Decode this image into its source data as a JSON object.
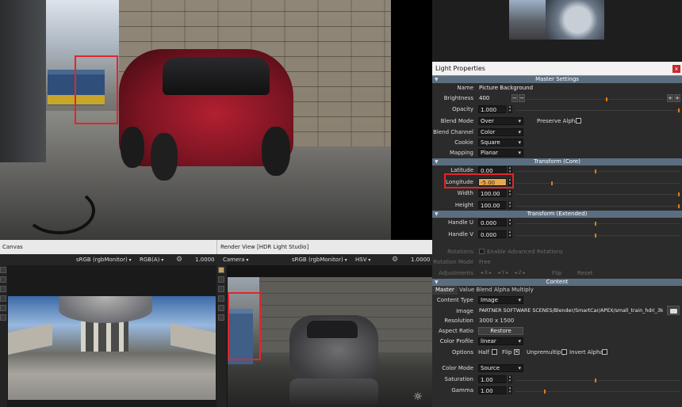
{
  "light_properties": {
    "title": "Light Properties",
    "close_label": "x",
    "sections": {
      "master": "Master Settings",
      "transform_core": "Transform (Core)",
      "transform_ext": "Transform (Extended)",
      "content": "Content"
    },
    "name": {
      "label": "Name",
      "value": "Picture Background"
    },
    "brightness": {
      "label": "Brightness",
      "value": "400",
      "minus": "−",
      "plus": "+"
    },
    "opacity": {
      "label": "Opacity",
      "value": "1.000"
    },
    "blend_mode": {
      "label": "Blend Mode",
      "value": "Over"
    },
    "preserve_alpha": {
      "label": "Preserve Alpha"
    },
    "blend_channel": {
      "label": "Blend Channel",
      "value": "Color"
    },
    "cookie": {
      "label": "Cookie",
      "value": "Square"
    },
    "mapping": {
      "label": "Mapping",
      "value": "Planar"
    },
    "latitude": {
      "label": "Latitude",
      "value": "0.00",
      "level": 0.5
    },
    "longitude": {
      "label": "Longitude",
      "value": "-5.00",
      "level": 0.49
    },
    "width": {
      "label": "Width",
      "value": "100.00",
      "level": 1.0
    },
    "height": {
      "label": "Height",
      "value": "100.00",
      "level": 1.0
    },
    "handle_u": {
      "label": "Handle U",
      "value": "0.000",
      "level": 0.5
    },
    "handle_v": {
      "label": "Handle V",
      "value": "0.000",
      "level": 0.5
    },
    "rotations": {
      "label": "Rotations",
      "checkbox_label": "Enable Advanced Rotations"
    },
    "rotation_mode": {
      "label": "Rotation Mode",
      "value": "Free"
    },
    "adjustments": {
      "label": "Adjustments",
      "flip": "Flip",
      "reset": "Reset"
    },
    "tabs": [
      "Master",
      "Value Blend",
      "Alpha Multiply"
    ],
    "content_type": {
      "label": "Content Type",
      "value": "Image"
    },
    "image": {
      "label": "Image",
      "value": "PARTNER SOFTWARE SCENES/Blender/SmartCar/APEX/small_train_hdri_3k.hdr.tx"
    },
    "resolution": {
      "label": "Resolution",
      "value": "3000 x 1500"
    },
    "aspect_ratio": {
      "label": "Aspect Ratio",
      "button": "Restore"
    },
    "color_profile": {
      "label": "Color Profile",
      "value": "linear"
    },
    "options": {
      "label": "Options",
      "half": "Half",
      "flip": "Flip",
      "unpremultiply": "Unpremultiply",
      "invert_alpha": "Invert Alpha"
    },
    "color_mode": {
      "label": "Color Mode",
      "value": "Source"
    },
    "saturation": {
      "label": "Saturation",
      "value": "1.00",
      "level": 0.5
    },
    "gamma": {
      "label": "Gamma",
      "value": "1.00",
      "level": 0.3
    }
  },
  "canvas": {
    "title": "Canvas",
    "color_space": "sRGB (rgbMonitor)",
    "channels": "RGB(A)",
    "zoom": "1.0000"
  },
  "render_view": {
    "title": "Render View [HDR Light Studio]",
    "camera": "Camera",
    "color_space": "sRGB (rgbMonitor)",
    "mode": "HSV",
    "zoom": "1.0000"
  },
  "colors": {
    "highlight_box": "#e0262b",
    "section_header": "#5b6e80",
    "slider_thumb": "#e07a18"
  },
  "icons": [
    "close-icon",
    "gear-icon",
    "folder-icon",
    "sun-icon",
    "paint-icon",
    "cursor-icon",
    "hand-icon",
    "zoom-icon"
  ]
}
